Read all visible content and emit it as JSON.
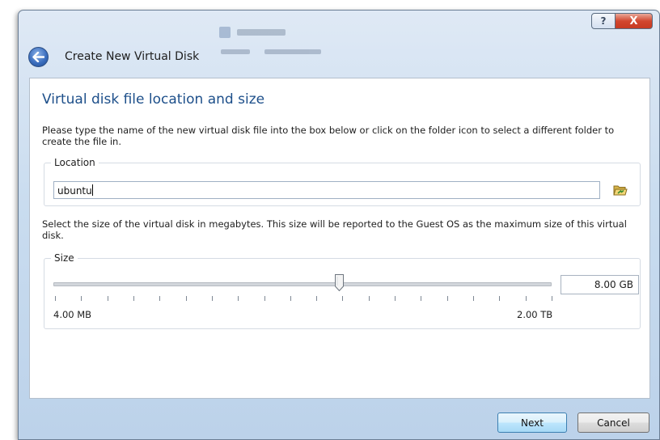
{
  "window": {
    "help_glyph": "?",
    "close_glyph": "X",
    "wizard_title": "Create New Virtual Disk"
  },
  "page": {
    "heading": "Virtual disk file location and size",
    "location_description": "Please type the name of the new virtual disk file into the box below or click on the folder icon to select a different folder to create the file in.",
    "size_description": "Select the size of the virtual disk in megabytes. This size will be reported to the Guest OS as the maximum size of this virtual disk."
  },
  "location": {
    "label": "Location",
    "value": "ubuntu",
    "folder_icon": "folder-open-icon"
  },
  "size": {
    "label": "Size",
    "value": "8.00 GB",
    "min_label": "4.00 MB",
    "max_label": "2.00 TB",
    "slider_fraction": 0.575
  },
  "buttons": {
    "next": "Next",
    "cancel": "Cancel"
  },
  "colors": {
    "heading": "#1d4f8a",
    "close_button": "#d2472f",
    "default_button_border": "#3c7fb1"
  }
}
